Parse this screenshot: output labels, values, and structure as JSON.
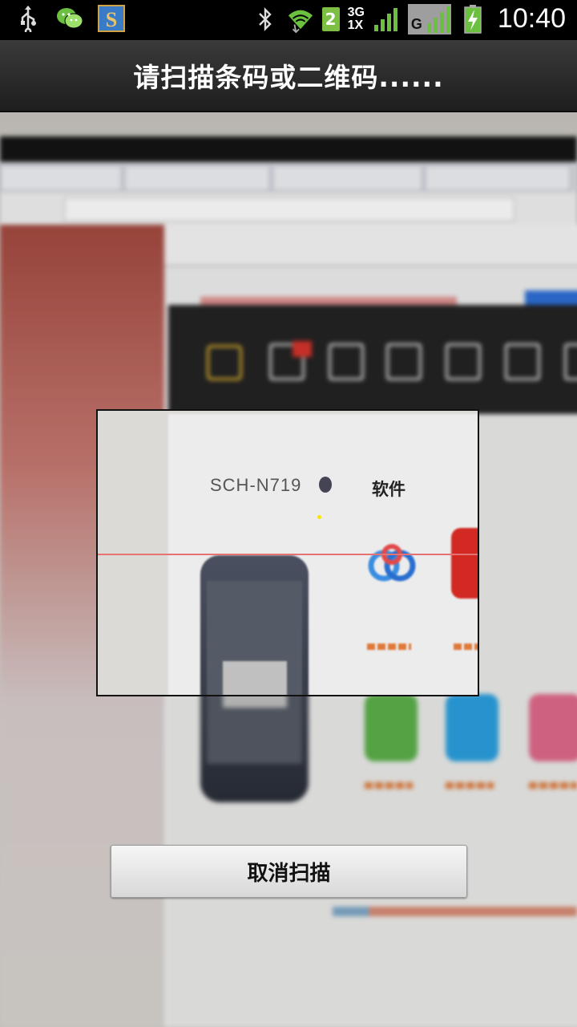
{
  "status_bar": {
    "time": "10:40",
    "sim_badge": "2",
    "network_type_top": "3G",
    "network_type_bottom": "1X",
    "carrier_signal_label": "G",
    "icons": [
      "usb-icon",
      "wechat-icon",
      "app-s-icon",
      "bluetooth-icon",
      "wifi-icon",
      "signal-icon",
      "battery-charging-icon"
    ],
    "app_s_letter": "S"
  },
  "header": {
    "title": "请扫描条码或二维码......"
  },
  "viewfinder": {
    "device_model": "SCH-N719",
    "tab_label": "软件"
  },
  "actions": {
    "cancel_label": "取消扫描"
  },
  "colors": {
    "scan_line": "#e57373",
    "title_bar": "#2a2a2a",
    "status_bar": "#000000"
  }
}
